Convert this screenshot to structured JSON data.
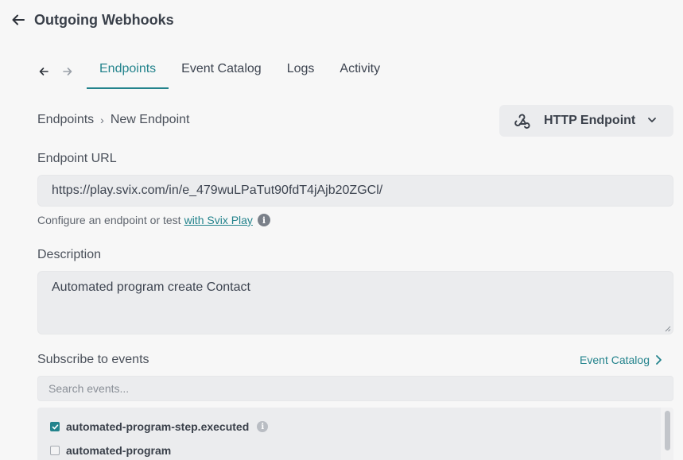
{
  "header": {
    "title": "Outgoing Webhooks",
    "back_icon": "arrow-left-icon"
  },
  "tabs": {
    "items": [
      {
        "label": "Endpoints",
        "active": true
      },
      {
        "label": "Event Catalog",
        "active": false
      },
      {
        "label": "Logs",
        "active": false
      },
      {
        "label": "Activity",
        "active": false
      }
    ]
  },
  "breadcrumb": {
    "parent": "Endpoints",
    "separator": "›",
    "current": "New Endpoint"
  },
  "endpoint_type": {
    "label": "HTTP Endpoint",
    "icon": "webhook-icon"
  },
  "form": {
    "url_label": "Endpoint URL",
    "url_value": "https://play.svix.com/in/e_479wuLPaTut90fdT4jAjb20ZGCl/",
    "helper_text": "Configure an endpoint or test",
    "helper_link": "with Svix Play",
    "description_label": "Description",
    "description_value": "Automated program create Contact",
    "subscribe_label": "Subscribe to events",
    "event_catalog_link": "Event Catalog",
    "search_placeholder": "Search events..."
  },
  "events": [
    {
      "name": "automated-program-step.executed",
      "checked": true
    },
    {
      "name": "automated-program",
      "checked": false
    }
  ],
  "colors": {
    "accent": "#23838c",
    "background": "#f7f7f7",
    "field": "#ebecee"
  }
}
